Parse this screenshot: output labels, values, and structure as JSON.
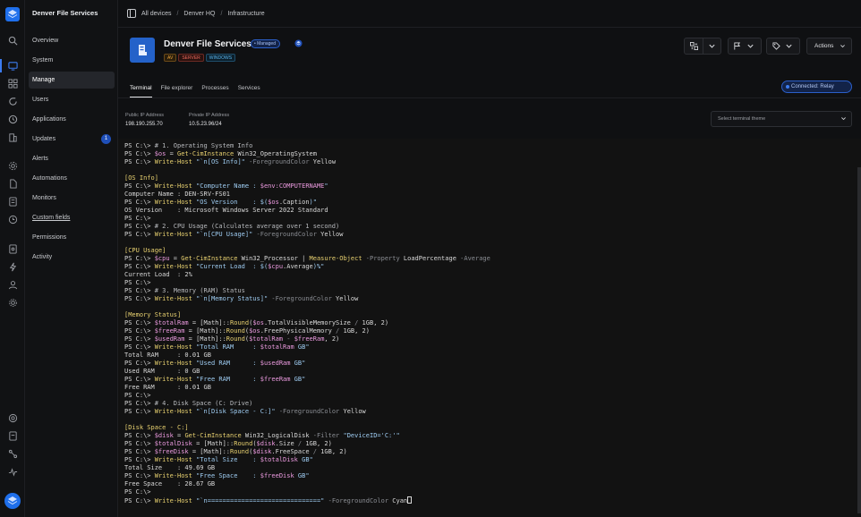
{
  "app": {
    "brand": "Denver File Services"
  },
  "breadcrumb": [
    "All devices",
    "Denver HQ",
    "Infrastructure"
  ],
  "nav": {
    "items": [
      {
        "label": "Overview"
      },
      {
        "label": "System"
      },
      {
        "label": "Manage",
        "active": true
      },
      {
        "label": "Users"
      },
      {
        "label": "Applications"
      },
      {
        "label": "Updates",
        "badge": "1"
      },
      {
        "label": "Alerts"
      },
      {
        "label": "Automations"
      },
      {
        "label": "Monitors"
      },
      {
        "label": "Custom fields"
      },
      {
        "label": "Permissions"
      },
      {
        "label": "Activity"
      }
    ]
  },
  "device": {
    "title": "Denver File Services",
    "managed": "Managed",
    "tags": [
      "AV",
      "SERVER",
      "WINDOWS"
    ],
    "actions_label": "Actions"
  },
  "tabs": [
    "Terminal",
    "File explorer",
    "Processes",
    "Services"
  ],
  "status": {
    "connection": "Connected: Relay"
  },
  "ip": {
    "public_label": "Public IP Address",
    "public_value": "198.190.255.70",
    "private_label": "Private IP Address",
    "private_value": "10.5.23.96/24"
  },
  "theme_select": {
    "placeholder": "Select terminal theme"
  },
  "colors": {
    "accent": "#2462c9",
    "tag_av": "#e8a13a",
    "tag_server": "#ef6b5f",
    "tag_windows": "#5ab6ef"
  },
  "terminal": {
    "lines": [
      [
        [
          "p",
          "PS C:\\> "
        ],
        [
          "cmt",
          "# 1. Operating System Info"
        ]
      ],
      [
        [
          "p",
          "PS C:\\> "
        ],
        [
          "v",
          "$os"
        ],
        [
          "p",
          " = "
        ],
        [
          "k",
          "Get-CimInstance"
        ],
        [
          "p",
          " Win32_OperatingSystem"
        ]
      ],
      [
        [
          "p",
          "PS C:\\> "
        ],
        [
          "k",
          "Write-Host"
        ],
        [
          "p",
          " "
        ],
        [
          "s",
          "\"`n[OS Info]\""
        ],
        [
          "p",
          " "
        ],
        [
          "d",
          "-ForegroundColor"
        ],
        [
          "p",
          " Yellow"
        ]
      ],
      [],
      [
        [
          "y",
          "[OS Info]"
        ]
      ],
      [
        [
          "p",
          "PS C:\\> "
        ],
        [
          "k",
          "Write-Host"
        ],
        [
          "p",
          " "
        ],
        [
          "s",
          "\"Computer Name : "
        ],
        [
          "v",
          "$env:COMPUTERNAME"
        ],
        [
          "s",
          "\""
        ]
      ],
      [
        [
          "p",
          "Computer Name : DEN-SRV-FS01"
        ]
      ],
      [
        [
          "p",
          "PS C:\\> "
        ],
        [
          "k",
          "Write-Host"
        ],
        [
          "p",
          " "
        ],
        [
          "s",
          "\"OS Version    : $("
        ],
        [
          "v",
          "$os"
        ],
        [
          "p",
          ".Caption"
        ],
        [
          "s",
          ")\""
        ]
      ],
      [
        [
          "p",
          "OS Version    : Microsoft Windows Server 2022 Standard"
        ]
      ],
      [
        [
          "p",
          "PS C:\\>"
        ]
      ],
      [
        [
          "p",
          "PS C:\\> "
        ],
        [
          "cmt",
          "# 2. CPU Usage (Calculates average over 1 second)"
        ]
      ],
      [
        [
          "p",
          "PS C:\\> "
        ],
        [
          "k",
          "Write-Host"
        ],
        [
          "p",
          " "
        ],
        [
          "s",
          "\"`n[CPU Usage]\""
        ],
        [
          "p",
          " "
        ],
        [
          "d",
          "-ForegroundColor"
        ],
        [
          "p",
          " Yellow"
        ]
      ],
      [],
      [
        [
          "y",
          "[CPU Usage]"
        ]
      ],
      [
        [
          "p",
          "PS C:\\> "
        ],
        [
          "v",
          "$cpu"
        ],
        [
          "p",
          " = "
        ],
        [
          "k",
          "Get-CimInstance"
        ],
        [
          "p",
          " Win32_Processor | "
        ],
        [
          "k",
          "Measure-Object"
        ],
        [
          "p",
          " "
        ],
        [
          "d",
          "-Property"
        ],
        [
          "p",
          " LoadPercentage "
        ],
        [
          "d",
          "-Average"
        ]
      ],
      [
        [
          "p",
          "PS C:\\> "
        ],
        [
          "k",
          "Write-Host"
        ],
        [
          "p",
          " "
        ],
        [
          "s",
          "\"Current Load  : $("
        ],
        [
          "v",
          "$cpu"
        ],
        [
          "p",
          ".Average"
        ],
        [
          "s",
          ")%\""
        ]
      ],
      [
        [
          "p",
          "Current Load  : 2%"
        ]
      ],
      [
        [
          "p",
          "PS C:\\>"
        ]
      ],
      [
        [
          "p",
          "PS C:\\> "
        ],
        [
          "cmt",
          "# 3. Memory (RAM) Status"
        ]
      ],
      [
        [
          "p",
          "PS C:\\> "
        ],
        [
          "k",
          "Write-Host"
        ],
        [
          "p",
          " "
        ],
        [
          "s",
          "\"`n[Memory Status]\""
        ],
        [
          "p",
          " "
        ],
        [
          "d",
          "-ForegroundColor"
        ],
        [
          "p",
          " Yellow"
        ]
      ],
      [],
      [
        [
          "y",
          "[Memory Status]"
        ]
      ],
      [
        [
          "p",
          "PS C:\\> "
        ],
        [
          "v",
          "$totalRam"
        ],
        [
          "p",
          " = [Math]::"
        ],
        [
          "k",
          "Round"
        ],
        [
          "p",
          "("
        ],
        [
          "v",
          "$os"
        ],
        [
          "p",
          ".TotalVisibleMemorySize "
        ],
        [
          "d",
          "/"
        ],
        [
          "p",
          " 1GB, 2)"
        ]
      ],
      [
        [
          "p",
          "PS C:\\> "
        ],
        [
          "v",
          "$freeRam"
        ],
        [
          "p",
          " = [Math]::"
        ],
        [
          "k",
          "Round"
        ],
        [
          "p",
          "("
        ],
        [
          "v",
          "$os"
        ],
        [
          "p",
          ".FreePhysicalMemory "
        ],
        [
          "d",
          "/"
        ],
        [
          "p",
          " 1GB, 2)"
        ]
      ],
      [
        [
          "p",
          "PS C:\\> "
        ],
        [
          "v",
          "$usedRam"
        ],
        [
          "p",
          " = [Math]::"
        ],
        [
          "k",
          "Round"
        ],
        [
          "p",
          "("
        ],
        [
          "v",
          "$totalRam"
        ],
        [
          "p",
          " "
        ],
        [
          "d",
          "-"
        ],
        [
          "p",
          " "
        ],
        [
          "v",
          "$freeRam"
        ],
        [
          "p",
          ", 2)"
        ]
      ],
      [
        [
          "p",
          "PS C:\\> "
        ],
        [
          "k",
          "Write-Host"
        ],
        [
          "p",
          " "
        ],
        [
          "s",
          "\"Total RAM     : "
        ],
        [
          "v",
          "$totalRam"
        ],
        [
          "s",
          " GB\""
        ]
      ],
      [
        [
          "p",
          "Total RAM     : 0.01 GB"
        ]
      ],
      [
        [
          "p",
          "PS C:\\> "
        ],
        [
          "k",
          "Write-Host"
        ],
        [
          "p",
          " "
        ],
        [
          "s",
          "\"Used RAM      : "
        ],
        [
          "v",
          "$usedRam"
        ],
        [
          "s",
          " GB\""
        ]
      ],
      [
        [
          "p",
          "Used RAM      : 0 GB"
        ]
      ],
      [
        [
          "p",
          "PS C:\\> "
        ],
        [
          "k",
          "Write-Host"
        ],
        [
          "p",
          " "
        ],
        [
          "s",
          "\"Free RAM      : "
        ],
        [
          "v",
          "$freeRam"
        ],
        [
          "s",
          " GB\""
        ]
      ],
      [
        [
          "p",
          "Free RAM      : 0.01 GB"
        ]
      ],
      [
        [
          "p",
          "PS C:\\>"
        ]
      ],
      [
        [
          "p",
          "PS C:\\> "
        ],
        [
          "cmt",
          "# 4. Disk Space (C: Drive)"
        ]
      ],
      [
        [
          "p",
          "PS C:\\> "
        ],
        [
          "k",
          "Write-Host"
        ],
        [
          "p",
          " "
        ],
        [
          "s",
          "\"`n[Disk Space - C:]\""
        ],
        [
          "p",
          " "
        ],
        [
          "d",
          "-ForegroundColor"
        ],
        [
          "p",
          " Yellow"
        ]
      ],
      [],
      [
        [
          "y",
          "[Disk Space - C:]"
        ]
      ],
      [
        [
          "p",
          "PS C:\\> "
        ],
        [
          "v",
          "$disk"
        ],
        [
          "p",
          " = "
        ],
        [
          "k",
          "Get-CimInstance"
        ],
        [
          "p",
          " Win32_LogicalDisk "
        ],
        [
          "d",
          "-Filter"
        ],
        [
          "p",
          " "
        ],
        [
          "s",
          "\"DeviceID='C:'\""
        ]
      ],
      [
        [
          "p",
          "PS C:\\> "
        ],
        [
          "v",
          "$totalDisk"
        ],
        [
          "p",
          " = [Math]::"
        ],
        [
          "k",
          "Round"
        ],
        [
          "p",
          "("
        ],
        [
          "v",
          "$disk"
        ],
        [
          "p",
          ".Size "
        ],
        [
          "d",
          "/"
        ],
        [
          "p",
          " 1GB, 2)"
        ]
      ],
      [
        [
          "p",
          "PS C:\\> "
        ],
        [
          "v",
          "$freeDisk"
        ],
        [
          "p",
          " = [Math]::"
        ],
        [
          "k",
          "Round"
        ],
        [
          "p",
          "("
        ],
        [
          "v",
          "$disk"
        ],
        [
          "p",
          ".FreeSpace "
        ],
        [
          "d",
          "/"
        ],
        [
          "p",
          " 1GB, 2)"
        ]
      ],
      [
        [
          "p",
          "PS C:\\> "
        ],
        [
          "k",
          "Write-Host"
        ],
        [
          "p",
          " "
        ],
        [
          "s",
          "\"Total Size    : "
        ],
        [
          "v",
          "$totalDisk"
        ],
        [
          "s",
          " GB\""
        ]
      ],
      [
        [
          "p",
          "Total Size    : 49.69 GB"
        ]
      ],
      [
        [
          "p",
          "PS C:\\> "
        ],
        [
          "k",
          "Write-Host"
        ],
        [
          "p",
          " "
        ],
        [
          "s",
          "\"Free Space    : "
        ],
        [
          "v",
          "$freeDisk"
        ],
        [
          "s",
          " GB\""
        ]
      ],
      [
        [
          "p",
          "Free Space    : 28.67 GB"
        ]
      ],
      [
        [
          "p",
          "PS C:\\>"
        ]
      ],
      [
        [
          "p",
          "PS C:\\> "
        ],
        [
          "k",
          "Write-Host"
        ],
        [
          "p",
          " "
        ],
        [
          "s",
          "\"`n==============================\""
        ],
        [
          "p",
          " "
        ],
        [
          "d",
          "-ForegroundColor"
        ],
        [
          "p",
          " Cyan"
        ]
      ]
    ]
  }
}
